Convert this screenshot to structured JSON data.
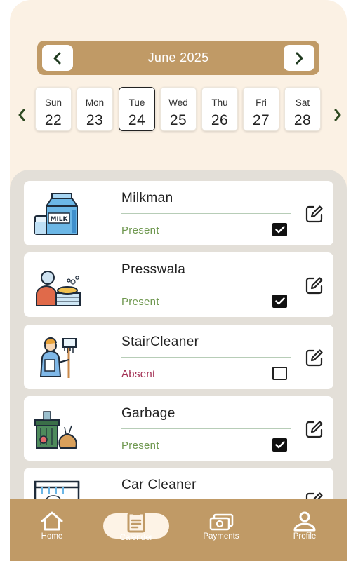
{
  "calendar": {
    "month_label": "June 2025",
    "prev_month_icon": "chevron-left-icon",
    "next_month_icon": "chevron-right-icon",
    "days": [
      {
        "name": "Sun",
        "num": "22"
      },
      {
        "name": "Mon",
        "num": "23"
      },
      {
        "name": "Tue",
        "num": "24",
        "selected": true
      },
      {
        "name": "Wed",
        "num": "25"
      },
      {
        "name": "Thu",
        "num": "26"
      },
      {
        "name": "Fri",
        "num": "27"
      },
      {
        "name": "Sat",
        "num": "28"
      }
    ]
  },
  "services": [
    {
      "name": "Milkman",
      "status": "Present",
      "checked": true,
      "icon": "milk-carton-icon"
    },
    {
      "name": "Presswala",
      "status": "Present",
      "checked": true,
      "icon": "ironing-person-icon"
    },
    {
      "name": "StairCleaner",
      "status": "Absent",
      "checked": false,
      "icon": "cleaner-mop-icon"
    },
    {
      "name": "Garbage",
      "status": "Present",
      "checked": true,
      "icon": "garbage-bin-icon"
    },
    {
      "name": "Car Cleaner",
      "status": "",
      "checked": false,
      "icon": "car-wash-icon"
    }
  ],
  "nav": {
    "home": "Home",
    "calendar": "Calender",
    "payments": "Payments",
    "profile": "Profile"
  },
  "colors": {
    "accent": "#c09a66",
    "background": "#fbf1e4",
    "panel": "#e3dfd8",
    "present": "#6f9850",
    "absent": "#a33054"
  }
}
